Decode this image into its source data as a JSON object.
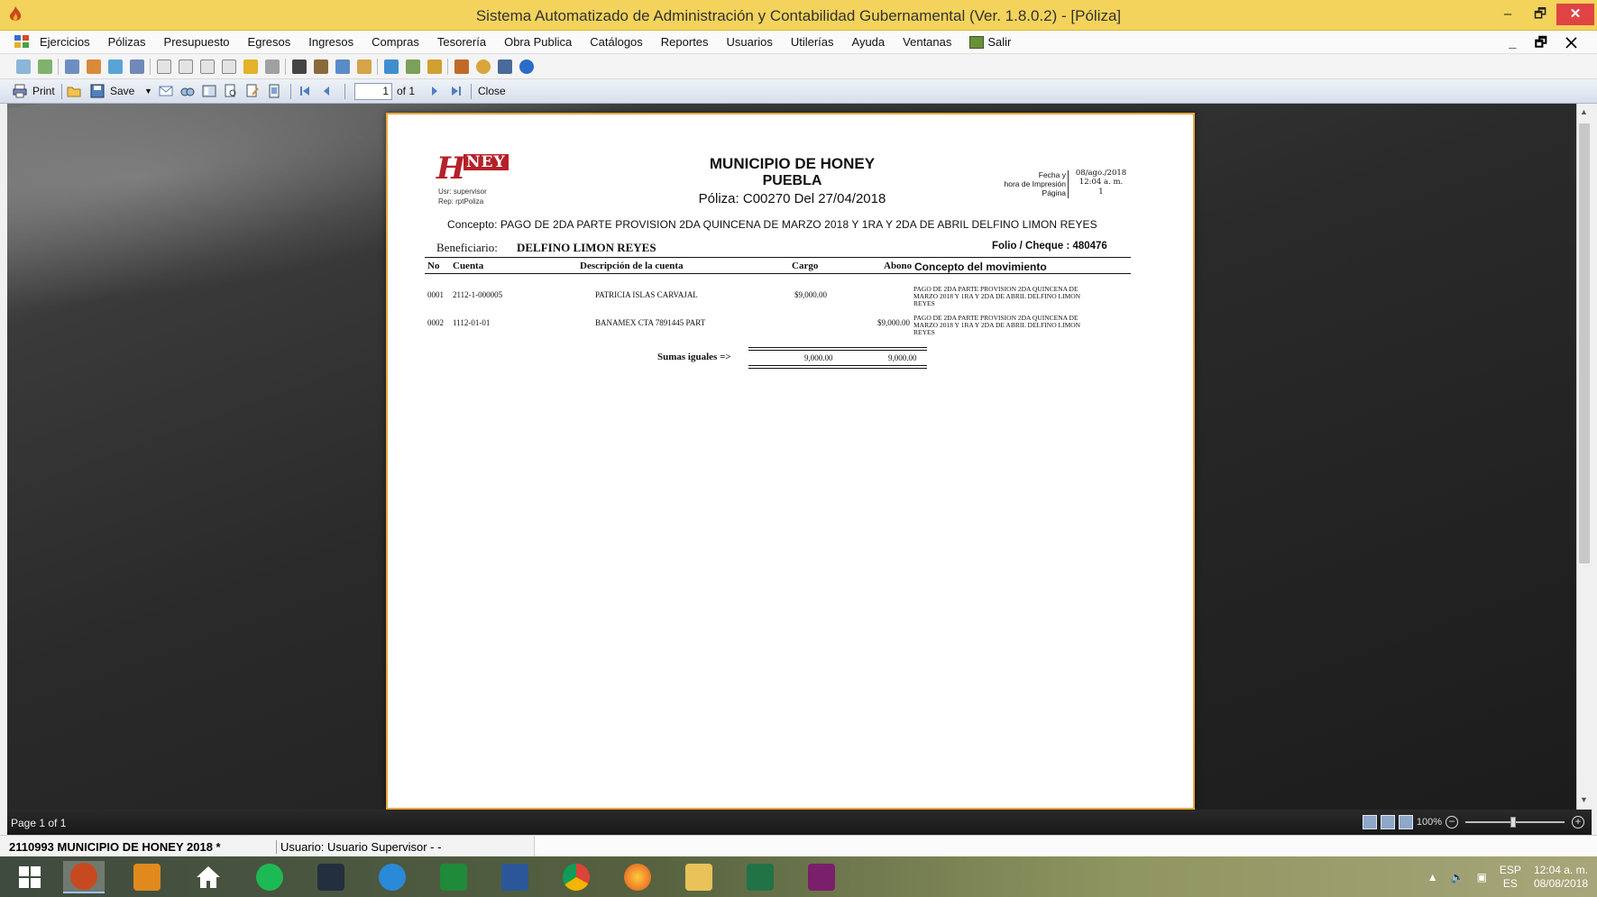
{
  "window": {
    "title": "Sistema Automatizado de Administración y Contabilidad Gubernamental  (Ver. 1.8.0.2) - [Póliza]",
    "min": "–",
    "restore": "🗗",
    "close": "✕"
  },
  "menu": {
    "items": [
      "Ejercicios",
      "Pólizas",
      "Presupuesto",
      "Egresos",
      "Ingresos",
      "Compras",
      "Tesorería",
      "Obra Publica",
      "Catálogos",
      "Reportes",
      "Usuarios",
      "Utilerías",
      "Ayuda",
      "Ventanas"
    ],
    "salir": "Salir",
    "mdi_controls": "_ 🗗 ✕"
  },
  "report_toolbar": {
    "print": "Print",
    "save": "Save",
    "page_value": "1",
    "of_pages": "of 1",
    "close": "Close"
  },
  "report": {
    "logo_h": "H",
    "logo_ney": "NEY",
    "usr_line": "Usr: supervisor",
    "rep_line": "Rep: rptPoliza",
    "municipio": "MUNICIPIO DE HONEY",
    "estado": "PUEBLA",
    "poliza_line": "Póliza:  C00270  Del 27/04/2018",
    "meta": {
      "fecha_lbl": "Fecha y",
      "hora_lbl": "hora de Impresión",
      "pagina_lbl": "Página",
      "fecha_val": "08/ago./2018",
      "hora_val": "12:04 a. m.",
      "pagina_val": "1"
    },
    "concepto": "Concepto:  PAGO DE 2DA PARTE PROVISION   2DA QUINCENA DE MARZO 2018 Y 1RA Y 2DA DE ABRIL DELFINO LIMON REYES",
    "beneficiario_lbl": "Beneficiario:",
    "beneficiario": "DELFINO LIMON REYES",
    "folio": "Folio / Cheque : 480476",
    "columns": {
      "no": "No",
      "cuenta": "Cuenta",
      "descripcion": "Descripción de la cuenta",
      "cargo": "Cargo",
      "abono": "Abono",
      "concepto": "Concepto del movimiento"
    },
    "rows": [
      {
        "no": "0001",
        "cuenta": "2112-1-000005",
        "descripcion": "PATRICIA ISLAS CARVAJAL",
        "cargo": "$9,000.00",
        "abono": "",
        "concepto": "PAGO DE 2DA PARTE PROVISION  2DA QUINCENA DE MARZO 2018 Y 1RA Y 2DA DE ABRIL DELFINO LIMON REYES"
      },
      {
        "no": "0002",
        "cuenta": "1112-01-01",
        "descripcion": "BANAMEX  CTA 7891445 PART",
        "cargo": "",
        "abono": "$9,000.00",
        "concepto": "PAGO DE 2DA PARTE PROVISION  2DA QUINCENA DE MARZO 2018 Y 1RA Y 2DA DE ABRIL DELFINO LIMON REYES"
      }
    ],
    "sumas_lbl": "Sumas iguales =>",
    "sum_cargo": "9,000.00",
    "sum_abono": "9,000.00"
  },
  "viewer_status": {
    "page": "Page 1 of 1",
    "zoom": "100%"
  },
  "app_status": {
    "db": "2110993 MUNICIPIO DE HONEY  2018   *",
    "user": "Usuario: Usuario Supervisor - -"
  },
  "taskbar": {
    "lang_top": "ESP",
    "lang_bottom": "ES",
    "time": "12:04 a. m.",
    "date": "08/08/2018"
  },
  "colors": {
    "titlebar": "#f3d35b",
    "paper_border": "#e8a83a",
    "logo_red": "#b5212a"
  }
}
